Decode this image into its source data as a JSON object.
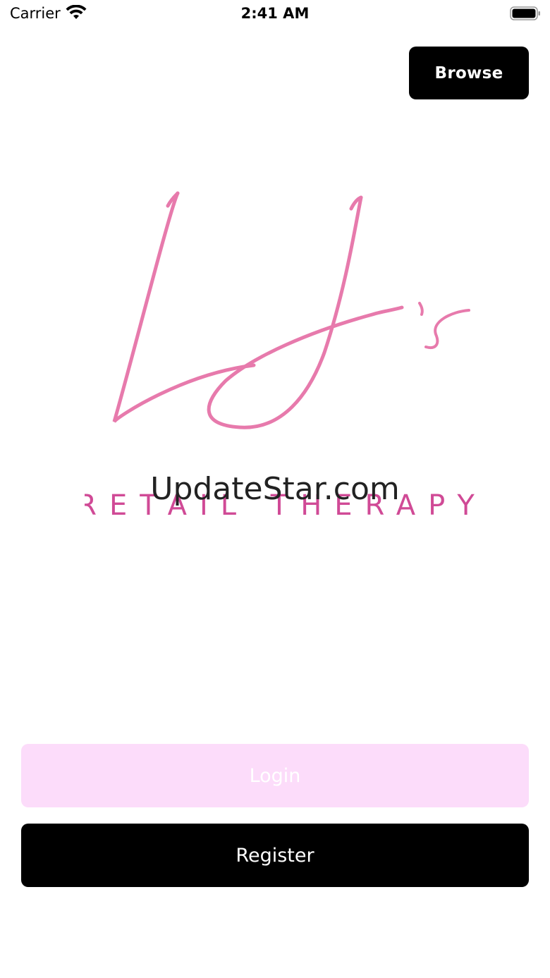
{
  "status_bar": {
    "carrier": "Carrier",
    "time": "2:41 AM"
  },
  "header": {
    "browse_label": "Browse"
  },
  "logo": {
    "brand_tagline": "RETAIL THERAPY",
    "color": "#e77aac"
  },
  "watermark": {
    "text": "UpdateStar.com"
  },
  "actions": {
    "login_label": "Login",
    "register_label": "Register",
    "login_bg": "#fcdcfa",
    "register_bg": "#000000"
  }
}
